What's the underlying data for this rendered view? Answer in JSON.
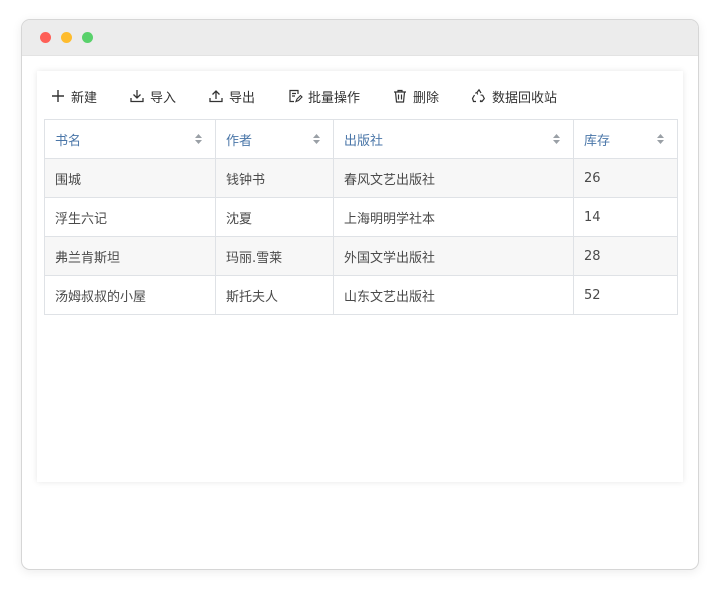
{
  "toolbar": {
    "new_label": "新建",
    "import_label": "导入",
    "export_label": "导出",
    "batch_label": "批量操作",
    "delete_label": "删除",
    "recycle_label": "数据回收站"
  },
  "table": {
    "headers": [
      "书名",
      "作者",
      "出版社",
      "库存"
    ],
    "rows": [
      [
        "围城",
        "钱钟书",
        "春风文艺出版社",
        "26"
      ],
      [
        "浮生六记",
        "沈夏",
        "上海明明学社本",
        "14"
      ],
      [
        "弗兰肯斯坦",
        "玛丽.雪莱",
        "外国文学出版社",
        "28"
      ],
      [
        "汤姆叔叔的小屋",
        "斯托夫人",
        "山东文艺出版社",
        "52"
      ]
    ]
  },
  "colors": {
    "header_text": "#4a76a8",
    "traffic_red": "#fe5f57",
    "traffic_yellow": "#febc2e",
    "traffic_green": "#28c840"
  }
}
